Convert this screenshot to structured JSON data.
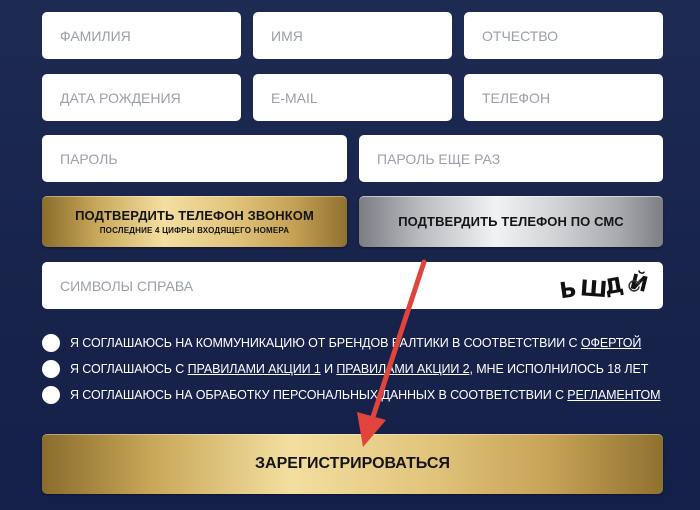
{
  "fields": {
    "surname": "ФАМИЛИЯ",
    "name": "ИМЯ",
    "patronymic": "ОТЧЕСТВО",
    "birthdate": "ДАТА РОЖДЕНИЯ",
    "email": "E-MAIL",
    "phone": "ТЕЛЕФОН",
    "password": "ПАРОЛЬ",
    "password_repeat": "ПАРОЛЬ ЕЩЕ РАЗ"
  },
  "verify": {
    "call_label": "ПОДТВЕРДИТЬ ТЕЛЕФОН ЗВОНКОМ",
    "call_sub": "ПОСЛЕДНИЕ 4 ЦИФРЫ ВХОДЯЩЕГО НОМЕРА",
    "sms_label": "ПОДТВЕРДИТЬ ТЕЛЕФОН ПО СМС"
  },
  "captcha": {
    "placeholder": "СИМВОЛЫ СПРАВА",
    "chars": [
      "Ь",
      "Ш",
      "Д",
      "Й"
    ]
  },
  "agreements": [
    {
      "before": "Я СОГЛАШАЮСЬ НА КОММУНИКАЦИЮ ОТ БРЕНДОВ БАЛТИКИ В СООТВЕТСТВИИ С ",
      "link1": "ОФЕРТОЙ"
    },
    {
      "before": "Я СОГЛАШАЮСЬ С ",
      "link1": "ПРАВИЛАМИ АКЦИИ 1",
      "middle": " И ",
      "link2": "ПРАВИЛАМИ АКЦИИ 2",
      "after": ", МНЕ ИСПОЛНИЛОСЬ 18 ЛЕТ"
    },
    {
      "before": "Я СОГЛАШАЮСЬ НА ОБРАБОТКУ ПЕРСОНАЛЬНЫХ ДАННЫХ В СООТВЕТСТВИИ С ",
      "link1": "РЕГЛАМЕНТОМ"
    }
  ],
  "submit_label": "ЗАРЕГИСТРИРОВАТЬСЯ",
  "colors": {
    "background": "#1b2850",
    "arrow": "#e0443c",
    "gold": "#e2c57d",
    "silver": "#d0d2d5"
  }
}
